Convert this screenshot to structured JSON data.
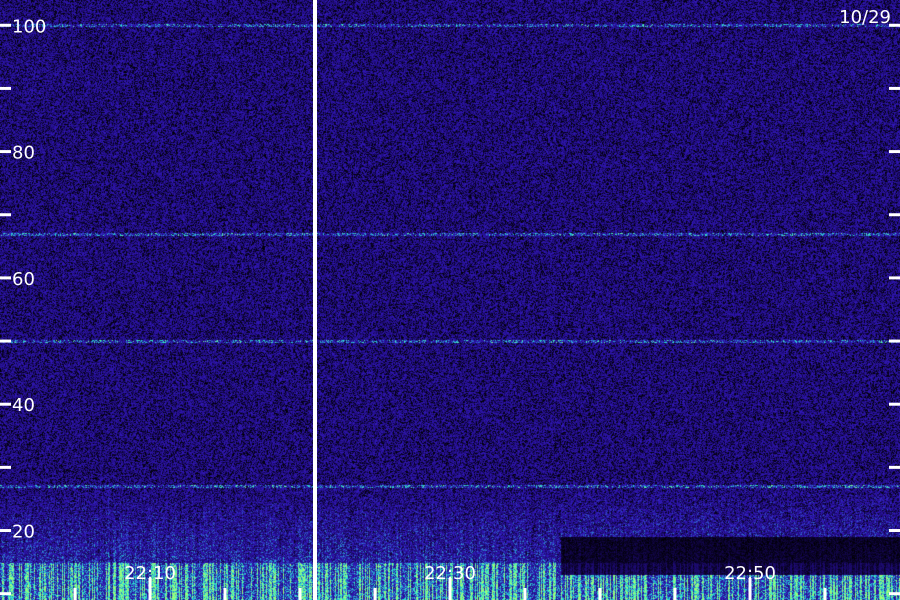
{
  "chart_data": {
    "type": "heatmap",
    "title": "",
    "date_label": "10/29",
    "xlabel": "",
    "ylabel": "",
    "x_tick_labels": [
      "22:10",
      "22:30",
      "22:50"
    ],
    "x_major_ticks": [
      "22:10",
      "22:30",
      "22:50"
    ],
    "x_range": [
      "22:00",
      "23:00"
    ],
    "x_minor_tick_interval_min": 5,
    "y_tick_labels": [
      "20",
      "40",
      "60",
      "80",
      "100"
    ],
    "y_range": [
      9,
      104
    ],
    "y_minor_tick_interval": 10,
    "marker_time": "22:21",
    "horizontal_bands": [
      100,
      67,
      50,
      27
    ],
    "colors": {
      "background": "#000000",
      "low": "#0b0033",
      "mid": "#3319c0",
      "high": "#25e7d5",
      "peak": "#9cff7a",
      "ticks": "#ffffff"
    }
  }
}
